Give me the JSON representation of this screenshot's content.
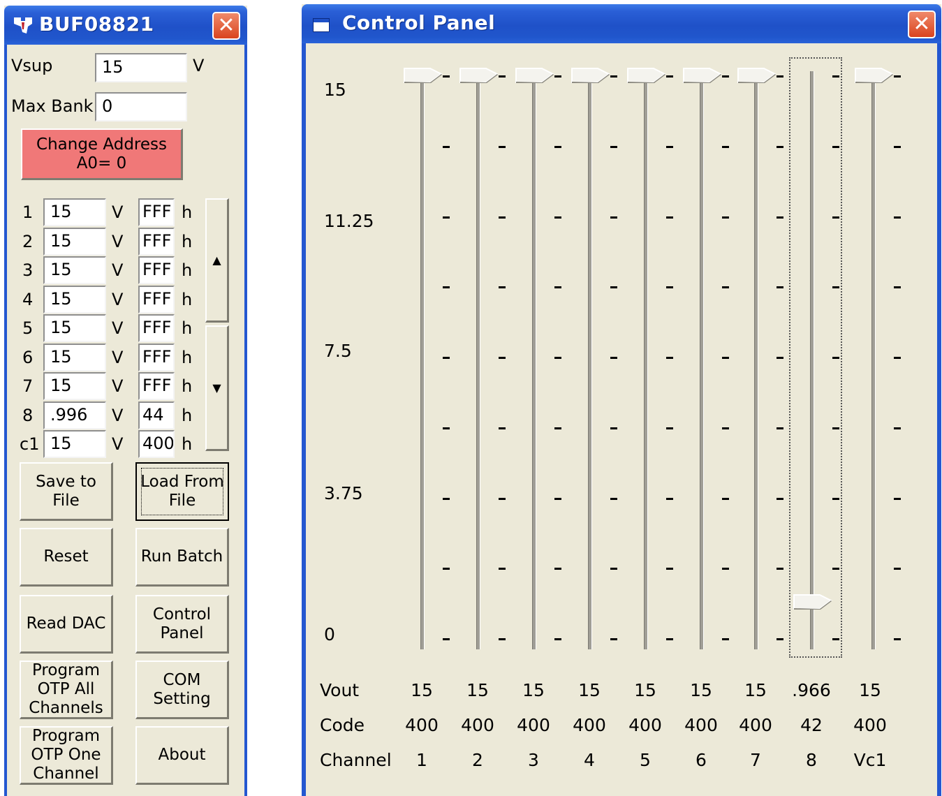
{
  "left_window": {
    "title": "BUF08821",
    "vsup": {
      "label": "Vsup",
      "value": "15",
      "unit": "V"
    },
    "max_bank": {
      "label": "Max Bank:",
      "value": "0"
    },
    "change_address_label": "Change Address\nA0= 0",
    "channels": [
      {
        "id": "1",
        "volts": "15",
        "unit": "V",
        "hex": "FFF",
        "suffix": "h"
      },
      {
        "id": "2",
        "volts": "15",
        "unit": "V",
        "hex": "FFF",
        "suffix": "h"
      },
      {
        "id": "3",
        "volts": "15",
        "unit": "V",
        "hex": "FFF",
        "suffix": "h"
      },
      {
        "id": "4",
        "volts": "15",
        "unit": "V",
        "hex": "FFF",
        "suffix": "h"
      },
      {
        "id": "5",
        "volts": "15",
        "unit": "V",
        "hex": "FFF",
        "suffix": "h"
      },
      {
        "id": "6",
        "volts": "15",
        "unit": "V",
        "hex": "FFF",
        "suffix": "h"
      },
      {
        "id": "7",
        "volts": "15",
        "unit": "V",
        "hex": "FFF",
        "suffix": "h"
      },
      {
        "id": "8",
        "volts": ".996",
        "unit": "V",
        "hex": "44",
        "suffix": "h"
      },
      {
        "id": "c1",
        "volts": "15",
        "unit": "V",
        "hex": "400",
        "suffix": "h"
      }
    ],
    "buttons": {
      "save_to_file": "Save to File",
      "load_from_file": "Load From\nFile",
      "reset": "Reset",
      "run_batch": "Run Batch",
      "read_dac": "Read DAC",
      "control_panel": "Control\nPanel",
      "program_otp_all": "Program\nOTP All\nChannels",
      "com_setting": "COM\nSetting",
      "program_otp_one": "Program\nOTP One\nChannel",
      "about": "About"
    },
    "colors": {
      "change_address_bg": "#f07878"
    }
  },
  "control_panel": {
    "title": "Control Panel",
    "scale_labels": [
      "15",
      "11.25",
      "7.5",
      "3.75",
      "0"
    ],
    "row_labels": {
      "vout": "Vout",
      "code": "Code",
      "channel": "Channel"
    },
    "sliders": [
      {
        "channel": "1",
        "vout": "15",
        "code": "400",
        "level": 1.0,
        "focused": false
      },
      {
        "channel": "2",
        "vout": "15",
        "code": "400",
        "level": 1.0,
        "focused": false
      },
      {
        "channel": "3",
        "vout": "15",
        "code": "400",
        "level": 1.0,
        "focused": false
      },
      {
        "channel": "4",
        "vout": "15",
        "code": "400",
        "level": 1.0,
        "focused": false
      },
      {
        "channel": "5",
        "vout": "15",
        "code": "400",
        "level": 1.0,
        "focused": false
      },
      {
        "channel": "6",
        "vout": "15",
        "code": "400",
        "level": 1.0,
        "focused": false
      },
      {
        "channel": "7",
        "vout": "15",
        "code": "400",
        "level": 1.0,
        "focused": false
      },
      {
        "channel": "8",
        "vout": ".966",
        "code": "42",
        "level": 0.064,
        "focused": true
      },
      {
        "channel": "Vc1",
        "vout": "15",
        "code": "400",
        "level": 1.0,
        "focused": false
      }
    ]
  }
}
